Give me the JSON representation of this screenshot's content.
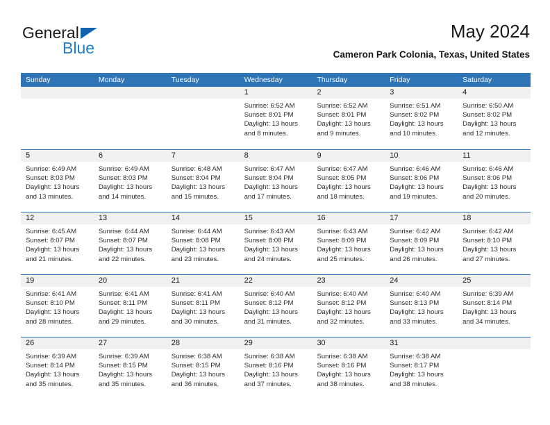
{
  "brand": {
    "name_part1": "General",
    "name_part2": "Blue",
    "triangle_color": "#1263ad",
    "blue_color": "#1f7ec4"
  },
  "header": {
    "title": "May 2024",
    "subtitle": "Cameron Park Colonia, Texas, United States"
  },
  "theme": {
    "header_blue": "#2f74b5",
    "daynum_band": "#f0f0f0",
    "separator": "#2f74b5",
    "text": "#2b2b2b"
  },
  "weekdays": [
    "Sunday",
    "Monday",
    "Tuesday",
    "Wednesday",
    "Thursday",
    "Friday",
    "Saturday"
  ],
  "weeks": [
    [
      {
        "day": "",
        "empty": true
      },
      {
        "day": "",
        "empty": true
      },
      {
        "day": "",
        "empty": true
      },
      {
        "day": "1",
        "sunrise": "Sunrise: 6:52 AM",
        "sunset": "Sunset: 8:01 PM",
        "daylight1": "Daylight: 13 hours",
        "daylight2": "and 8 minutes."
      },
      {
        "day": "2",
        "sunrise": "Sunrise: 6:52 AM",
        "sunset": "Sunset: 8:01 PM",
        "daylight1": "Daylight: 13 hours",
        "daylight2": "and 9 minutes."
      },
      {
        "day": "3",
        "sunrise": "Sunrise: 6:51 AM",
        "sunset": "Sunset: 8:02 PM",
        "daylight1": "Daylight: 13 hours",
        "daylight2": "and 10 minutes."
      },
      {
        "day": "4",
        "sunrise": "Sunrise: 6:50 AM",
        "sunset": "Sunset: 8:02 PM",
        "daylight1": "Daylight: 13 hours",
        "daylight2": "and 12 minutes."
      }
    ],
    [
      {
        "day": "5",
        "sunrise": "Sunrise: 6:49 AM",
        "sunset": "Sunset: 8:03 PM",
        "daylight1": "Daylight: 13 hours",
        "daylight2": "and 13 minutes."
      },
      {
        "day": "6",
        "sunrise": "Sunrise: 6:49 AM",
        "sunset": "Sunset: 8:03 PM",
        "daylight1": "Daylight: 13 hours",
        "daylight2": "and 14 minutes."
      },
      {
        "day": "7",
        "sunrise": "Sunrise: 6:48 AM",
        "sunset": "Sunset: 8:04 PM",
        "daylight1": "Daylight: 13 hours",
        "daylight2": "and 15 minutes."
      },
      {
        "day": "8",
        "sunrise": "Sunrise: 6:47 AM",
        "sunset": "Sunset: 8:04 PM",
        "daylight1": "Daylight: 13 hours",
        "daylight2": "and 17 minutes."
      },
      {
        "day": "9",
        "sunrise": "Sunrise: 6:47 AM",
        "sunset": "Sunset: 8:05 PM",
        "daylight1": "Daylight: 13 hours",
        "daylight2": "and 18 minutes."
      },
      {
        "day": "10",
        "sunrise": "Sunrise: 6:46 AM",
        "sunset": "Sunset: 8:06 PM",
        "daylight1": "Daylight: 13 hours",
        "daylight2": "and 19 minutes."
      },
      {
        "day": "11",
        "sunrise": "Sunrise: 6:46 AM",
        "sunset": "Sunset: 8:06 PM",
        "daylight1": "Daylight: 13 hours",
        "daylight2": "and 20 minutes."
      }
    ],
    [
      {
        "day": "12",
        "sunrise": "Sunrise: 6:45 AM",
        "sunset": "Sunset: 8:07 PM",
        "daylight1": "Daylight: 13 hours",
        "daylight2": "and 21 minutes."
      },
      {
        "day": "13",
        "sunrise": "Sunrise: 6:44 AM",
        "sunset": "Sunset: 8:07 PM",
        "daylight1": "Daylight: 13 hours",
        "daylight2": "and 22 minutes."
      },
      {
        "day": "14",
        "sunrise": "Sunrise: 6:44 AM",
        "sunset": "Sunset: 8:08 PM",
        "daylight1": "Daylight: 13 hours",
        "daylight2": "and 23 minutes."
      },
      {
        "day": "15",
        "sunrise": "Sunrise: 6:43 AM",
        "sunset": "Sunset: 8:08 PM",
        "daylight1": "Daylight: 13 hours",
        "daylight2": "and 24 minutes."
      },
      {
        "day": "16",
        "sunrise": "Sunrise: 6:43 AM",
        "sunset": "Sunset: 8:09 PM",
        "daylight1": "Daylight: 13 hours",
        "daylight2": "and 25 minutes."
      },
      {
        "day": "17",
        "sunrise": "Sunrise: 6:42 AM",
        "sunset": "Sunset: 8:09 PM",
        "daylight1": "Daylight: 13 hours",
        "daylight2": "and 26 minutes."
      },
      {
        "day": "18",
        "sunrise": "Sunrise: 6:42 AM",
        "sunset": "Sunset: 8:10 PM",
        "daylight1": "Daylight: 13 hours",
        "daylight2": "and 27 minutes."
      }
    ],
    [
      {
        "day": "19",
        "sunrise": "Sunrise: 6:41 AM",
        "sunset": "Sunset: 8:10 PM",
        "daylight1": "Daylight: 13 hours",
        "daylight2": "and 28 minutes."
      },
      {
        "day": "20",
        "sunrise": "Sunrise: 6:41 AM",
        "sunset": "Sunset: 8:11 PM",
        "daylight1": "Daylight: 13 hours",
        "daylight2": "and 29 minutes."
      },
      {
        "day": "21",
        "sunrise": "Sunrise: 6:41 AM",
        "sunset": "Sunset: 8:11 PM",
        "daylight1": "Daylight: 13 hours",
        "daylight2": "and 30 minutes."
      },
      {
        "day": "22",
        "sunrise": "Sunrise: 6:40 AM",
        "sunset": "Sunset: 8:12 PM",
        "daylight1": "Daylight: 13 hours",
        "daylight2": "and 31 minutes."
      },
      {
        "day": "23",
        "sunrise": "Sunrise: 6:40 AM",
        "sunset": "Sunset: 8:12 PM",
        "daylight1": "Daylight: 13 hours",
        "daylight2": "and 32 minutes."
      },
      {
        "day": "24",
        "sunrise": "Sunrise: 6:40 AM",
        "sunset": "Sunset: 8:13 PM",
        "daylight1": "Daylight: 13 hours",
        "daylight2": "and 33 minutes."
      },
      {
        "day": "25",
        "sunrise": "Sunrise: 6:39 AM",
        "sunset": "Sunset: 8:14 PM",
        "daylight1": "Daylight: 13 hours",
        "daylight2": "and 34 minutes."
      }
    ],
    [
      {
        "day": "26",
        "sunrise": "Sunrise: 6:39 AM",
        "sunset": "Sunset: 8:14 PM",
        "daylight1": "Daylight: 13 hours",
        "daylight2": "and 35 minutes."
      },
      {
        "day": "27",
        "sunrise": "Sunrise: 6:39 AM",
        "sunset": "Sunset: 8:15 PM",
        "daylight1": "Daylight: 13 hours",
        "daylight2": "and 35 minutes."
      },
      {
        "day": "28",
        "sunrise": "Sunrise: 6:38 AM",
        "sunset": "Sunset: 8:15 PM",
        "daylight1": "Daylight: 13 hours",
        "daylight2": "and 36 minutes."
      },
      {
        "day": "29",
        "sunrise": "Sunrise: 6:38 AM",
        "sunset": "Sunset: 8:16 PM",
        "daylight1": "Daylight: 13 hours",
        "daylight2": "and 37 minutes."
      },
      {
        "day": "30",
        "sunrise": "Sunrise: 6:38 AM",
        "sunset": "Sunset: 8:16 PM",
        "daylight1": "Daylight: 13 hours",
        "daylight2": "and 38 minutes."
      },
      {
        "day": "31",
        "sunrise": "Sunrise: 6:38 AM",
        "sunset": "Sunset: 8:17 PM",
        "daylight1": "Daylight: 13 hours",
        "daylight2": "and 38 minutes."
      },
      {
        "day": "",
        "empty": true
      }
    ]
  ]
}
